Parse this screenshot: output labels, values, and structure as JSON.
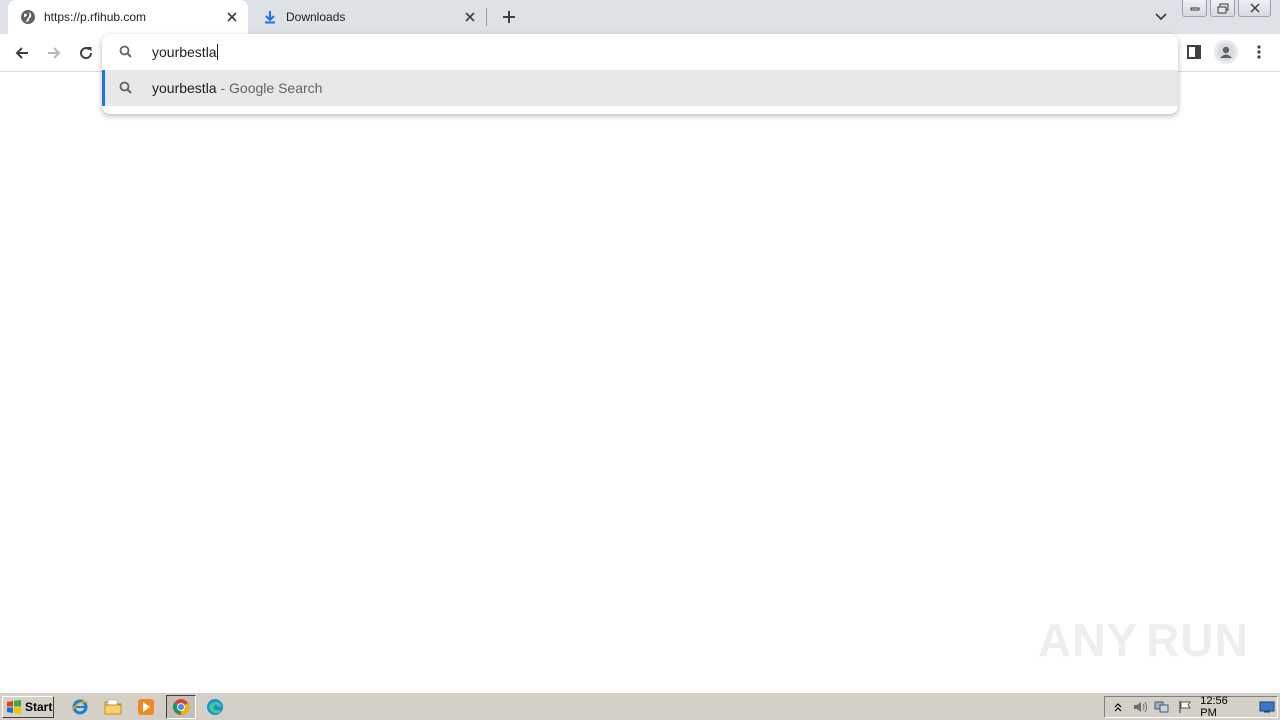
{
  "browser": {
    "tabs": [
      {
        "title": "https://p.rfihub.com",
        "icon": "globe-icon",
        "active": true
      },
      {
        "title": "Downloads",
        "icon": "download-icon",
        "active": false
      }
    ],
    "accent_color": "#1a73e8"
  },
  "omnibox": {
    "input_value": "yourbestla",
    "suggestions": [
      {
        "query": "yourbestla",
        "suffix": " - Google Search",
        "icon": "search-icon"
      }
    ]
  },
  "watermark": {
    "left": "ANY",
    "right": "RUN"
  },
  "taskbar": {
    "start_label": "Start",
    "pinned": [
      "ie-icon",
      "folder-icon",
      "media-player-icon",
      "chrome-icon",
      "edge-icon"
    ],
    "clock": "12:56 PM"
  }
}
